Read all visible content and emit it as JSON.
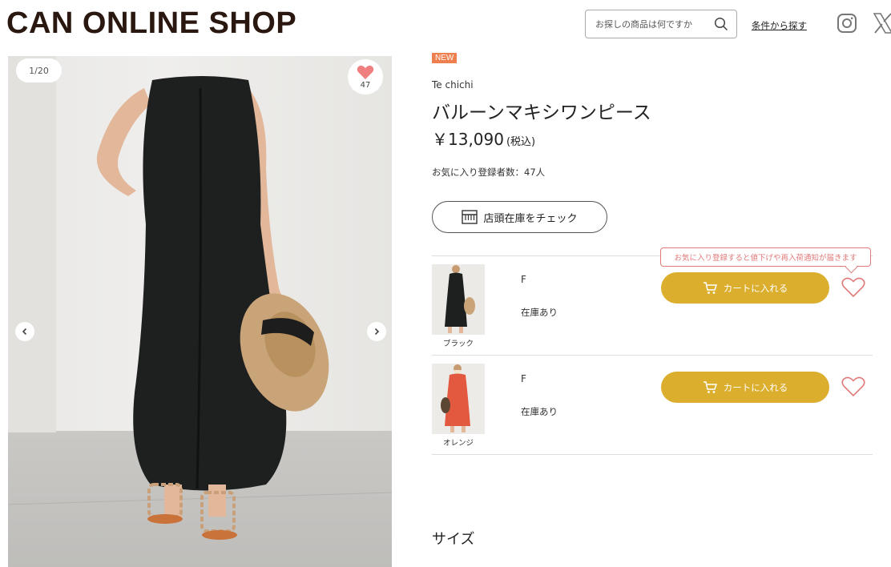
{
  "header": {
    "logo": "CAN ONLINE SHOP",
    "search_placeholder": "お探しの商品は何ですか",
    "condition_link": "条件から探す"
  },
  "gallery": {
    "pager": "1/20",
    "favorite_count": "47"
  },
  "product": {
    "badge": "NEW",
    "brand": "Te chichi",
    "title": "バルーンマキシワンピース",
    "price": "￥13,090",
    "tax_label": "(税込)",
    "favorite_registrants": "お気に入り登録者数：47人",
    "store_stock_button": "店頭在庫をチェック"
  },
  "tooltip": "お気に入り登録すると値下げや再入荷通知が届きます",
  "variants": [
    {
      "color": "ブラック",
      "size": "F",
      "stock": "在庫あり",
      "cart_label": "カートに入れる"
    },
    {
      "color": "オレンジ",
      "size": "F",
      "stock": "在庫あり",
      "cart_label": "カートに入れる"
    }
  ],
  "section": {
    "size_heading": "サイズ"
  },
  "colors": {
    "cart_button": "#dbae2e",
    "new_badge": "#ee8050",
    "heart": "#e07a7a",
    "logo": "#2a1810"
  }
}
